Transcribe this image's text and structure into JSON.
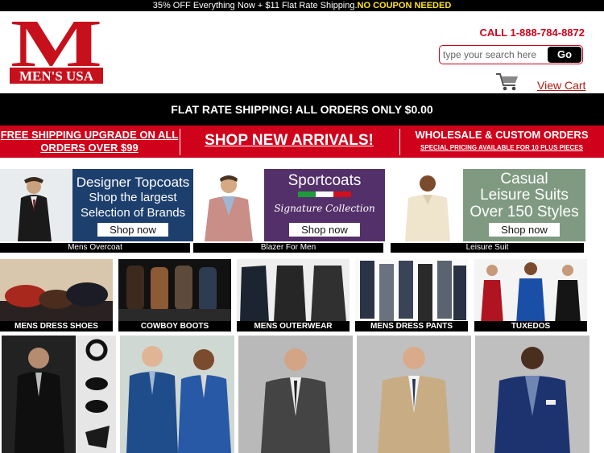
{
  "topbar": {
    "text": "35% OFF Everything Now + $11 Flat Rate Shipping.",
    "highlight": "NO COUPON NEEDED"
  },
  "logo": {
    "letter": "M",
    "name": "MEN'S USA"
  },
  "header": {
    "phone": "CALL 1-888-784-8872",
    "view_cart": "View Cart"
  },
  "search": {
    "placeholder": "type your search here",
    "go_label": "Go"
  },
  "shipping_bar": {
    "text": "FLAT RATE SHIPPING! ALL ORDERS ONLY $0.00"
  },
  "red_bar": {
    "free_shipping": "FREE SHIPPING UPGRADE ON ALL ORDERS OVER $99",
    "new_arrivals": "SHOP NEW ARRIVALS!",
    "wholesale": "WHOLESALE & CUSTOM ORDERS",
    "wholesale_sub": "SPECIAL PRICING AVAILABLE FOR 10 PLUS PIECES"
  },
  "promos": [
    {
      "line1": "Designer Topcoats",
      "line2": "Shop the largest",
      "line3": "Selection of Brands",
      "cta": "Shop now",
      "caption": "Mens Overcoat"
    },
    {
      "line1": "Sportcoats",
      "line2": "Signature Collection",
      "cta": "Shop now",
      "caption": "Blazer For Men"
    },
    {
      "line1": "Casual",
      "line2": "Leisure Suits",
      "line3": "Over 150 Styles",
      "cta": "Shop now",
      "caption": "Leisure Suit"
    }
  ],
  "categories": [
    "MENS DRESS SHOES",
    "COWBOY BOOTS",
    "MENS OUTERWEAR",
    "MENS DRESS PANTS",
    "TUXEDOS"
  ],
  "colors": {
    "brand_red": "#d0021b",
    "topcoat_panel": "#1d3f6e",
    "sportcoat_panel": "#54306a",
    "leisure_panel": "#7f9a81",
    "highlight_yellow": "#ffe21f"
  }
}
